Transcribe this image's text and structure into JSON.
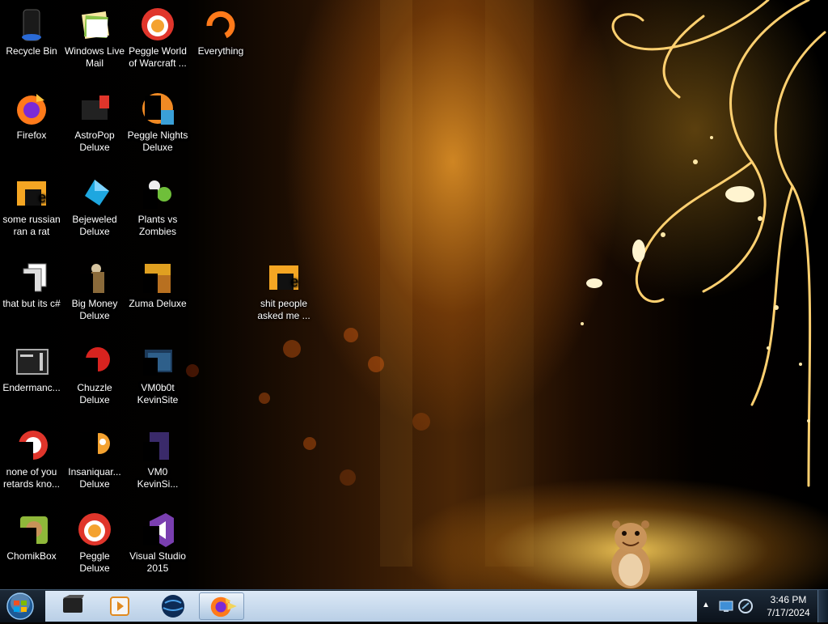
{
  "desktop": {
    "icons": [
      {
        "label": "Recycle Bin",
        "icon": "recycle-bin-icon"
      },
      {
        "label": "Windows Live Mail",
        "icon": "windows-live-mail-icon"
      },
      {
        "label": "Peggle World of Warcraft ...",
        "icon": "peggle-icon"
      },
      {
        "label": "Everything",
        "icon": "everything-search-icon"
      },
      {
        "label": "Firefox",
        "icon": "firefox-icon"
      },
      {
        "label": "AstroPop Deluxe",
        "icon": "astropop-icon"
      },
      {
        "label": "Peggle Nights Deluxe",
        "icon": "peggle-nights-icon"
      },
      {
        "label": "some russian ran a rat",
        "icon": "folder-icon"
      },
      {
        "label": "Bejeweled Deluxe",
        "icon": "bejeweled-icon"
      },
      {
        "label": "Plants vs Zombies",
        "icon": "plants-vs-zombies-icon"
      },
      {
        "label": "that but its c#",
        "icon": "file-shortcut-icon"
      },
      {
        "label": "Big Money Deluxe",
        "icon": "big-money-icon"
      },
      {
        "label": "Zuma Deluxe",
        "icon": "zuma-icon"
      },
      {
        "label": "shit people asked me ...",
        "icon": "folder-icon"
      },
      {
        "label": "Endermanc...",
        "icon": "terminal-icon"
      },
      {
        "label": "Chuzzle Deluxe",
        "icon": "chuzzle-icon"
      },
      {
        "label": "VM0b0t KevinSite",
        "icon": "vm-folder-icon"
      },
      {
        "label": "none of you retards kno...",
        "icon": "red-shortcut-icon"
      },
      {
        "label": "Insaniquar... Deluxe",
        "icon": "insaniquarium-icon"
      },
      {
        "label": "VM0 KevinSi...",
        "icon": "vm-file-icon"
      },
      {
        "label": "ChomikBox",
        "icon": "chomikbox-icon"
      },
      {
        "label": "Peggle Deluxe",
        "icon": "peggle-icon"
      },
      {
        "label": "Visual Studio 2015",
        "icon": "visual-studio-icon"
      }
    ]
  },
  "taskbar": {
    "start": {
      "icon": "windows-start-orb-icon"
    },
    "pinned": [
      {
        "icon": "media-center-icon",
        "active": false
      },
      {
        "icon": "media-player-icon",
        "active": false
      },
      {
        "icon": "browser-globe-icon",
        "active": false
      },
      {
        "icon": "firefox-icon",
        "active": true
      }
    ],
    "tray": {
      "icons": [
        "show-hidden-icons-icon",
        "network-icon",
        "volume-icon"
      ],
      "time": "3:46 PM",
      "date": "7/17/2024"
    }
  },
  "colors": {
    "taskbar_strip": "#c9dbee",
    "accent": "#f0a020"
  }
}
